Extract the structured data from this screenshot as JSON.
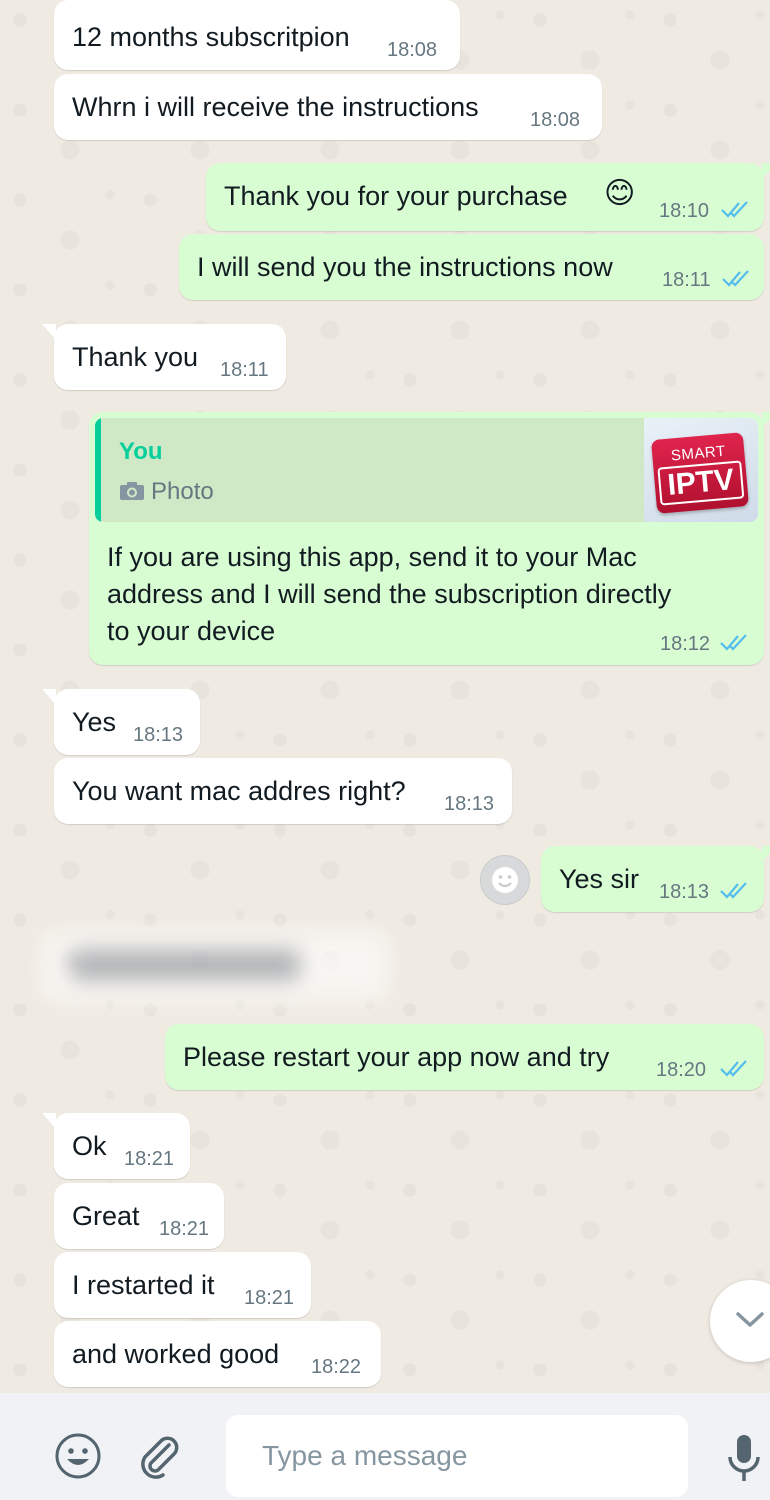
{
  "chat": {
    "messages": [
      {
        "dir": "in",
        "text": "12 months subscritpion",
        "time": "18:08"
      },
      {
        "dir": "in",
        "text": "Whrn i will receive the instructions",
        "time": "18:08"
      },
      {
        "dir": "out",
        "text": "Thank you for your purchase",
        "emoji": "😊",
        "time": "18:10",
        "status": "read"
      },
      {
        "dir": "out",
        "text": "I will send you the instructions now",
        "time": "18:11",
        "status": "read"
      },
      {
        "dir": "in",
        "text": "Thank you",
        "time": "18:11"
      },
      {
        "dir": "out",
        "quote": {
          "author": "You",
          "type": "Photo",
          "thumb_text_top": "SMART",
          "thumb_text_main": "IPTV"
        },
        "lines": [
          "If you are using this app, send it to your Mac",
          "address and I will send the subscription directly",
          "to your device"
        ],
        "time": "18:12",
        "status": "read"
      },
      {
        "dir": "in",
        "text": "Yes",
        "time": "18:13"
      },
      {
        "dir": "in",
        "text": "You want mac addres right?",
        "time": "18:13"
      },
      {
        "dir": "out",
        "text": "Yes sir",
        "time": "18:13",
        "status": "read",
        "reaction_button": "smiley-icon"
      },
      {
        "dir": "out",
        "text": "Please restart your app now and try",
        "time": "18:20",
        "status": "read"
      },
      {
        "dir": "in",
        "text": "Ok",
        "time": "18:21"
      },
      {
        "dir": "in",
        "text": "Great",
        "time": "18:21"
      },
      {
        "dir": "in",
        "text": "I restarted it",
        "time": "18:21"
      },
      {
        "dir": "in",
        "text": "and worked good",
        "time": "18:22"
      }
    ]
  },
  "composer": {
    "placeholder": "Type a message",
    "icons": [
      "emoji-icon",
      "attach-icon",
      "microphone-icon"
    ]
  },
  "scroll_button_icon": "chevron-down-icon",
  "colors": {
    "background": "#efeae2",
    "incoming": "#ffffff",
    "outgoing": "#d9fdd3",
    "read_tick": "#53bdeb",
    "quote_accent": "#06cf9c",
    "footer": "#f0f2f5"
  }
}
